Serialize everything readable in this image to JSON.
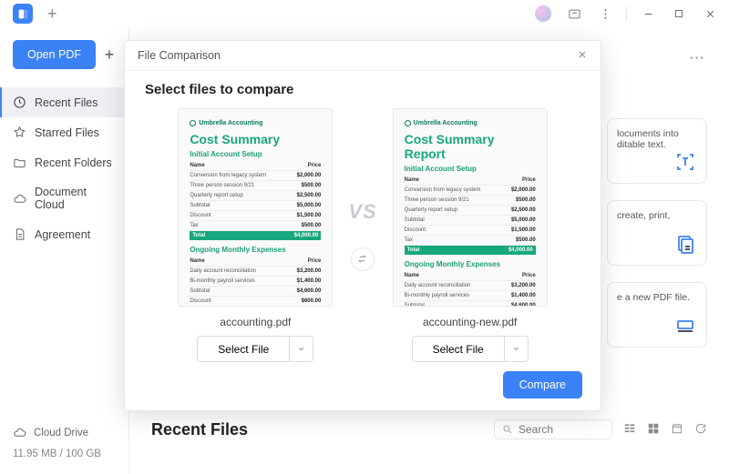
{
  "titlebar": {
    "app_logo": "P"
  },
  "sidebar": {
    "open_label": "Open PDF",
    "items": [
      {
        "label": "Recent Files"
      },
      {
        "label": "Starred Files"
      },
      {
        "label": "Recent Folders"
      },
      {
        "label": "Document Cloud"
      },
      {
        "label": "Agreement"
      }
    ],
    "cloud_drive_label": "Cloud Drive",
    "storage_text": "11.95 MB / 100 GB"
  },
  "content": {
    "recent_title": "Recent Files",
    "search_placeholder": "Search",
    "cards": [
      {
        "text": "locuments into ditable text."
      },
      {
        "text": "create, print,"
      },
      {
        "text": "e a new PDF file."
      }
    ]
  },
  "modal": {
    "title": "File Comparison",
    "subtitle": "Select files to compare",
    "vs_label": "VS",
    "left": {
      "filename": "accounting.pdf",
      "select_label": "Select File",
      "brand": "Umbrella Accounting",
      "doc_title": "Cost Summary",
      "section1": "Initial Account Setup",
      "section2": "Ongoing Monthly Expenses",
      "col_name": "Name",
      "col_price": "Price",
      "total_label": "Total"
    },
    "right": {
      "filename": "accounting-new.pdf",
      "select_label": "Select File",
      "brand": "Umbrella Accounting",
      "doc_title": "Cost Summary Report",
      "section1": "Initial Account Setup",
      "section2": "Ongoing Monthly Expenses",
      "col_name": "Name",
      "col_price": "Price",
      "total_label": "Total"
    },
    "compare_label": "Compare"
  }
}
